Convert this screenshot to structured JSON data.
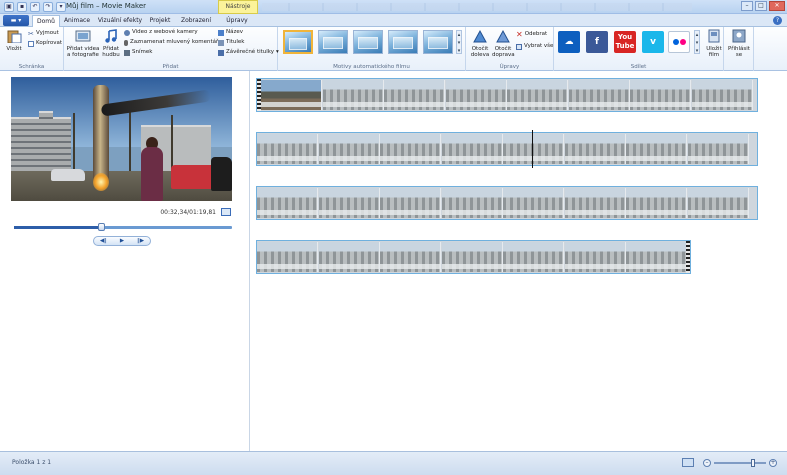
{
  "window": {
    "title": "Můj film – Movie Maker",
    "contextual_tab": "Nástroje videa",
    "minimize": "–",
    "maximize": "□",
    "close": "✕"
  },
  "tabs": [
    {
      "label": "Domů",
      "active": true
    },
    {
      "label": "Animace",
      "active": false
    },
    {
      "label": "Vizuální efekty",
      "active": false
    },
    {
      "label": "Projekt",
      "active": false
    },
    {
      "label": "Zobrazení",
      "active": false
    },
    {
      "label": "Úpravy",
      "active": false
    }
  ],
  "ribbon": {
    "clipboard": {
      "group_label": "Schránka",
      "paste": "Vložit",
      "cut": "Vyjmout",
      "copy": "Kopírovat"
    },
    "add": {
      "group_label": "Přidat",
      "add_video_photos": "Přidat videa a fotografie",
      "add_music": "Přidat hudbu",
      "webcam_video": "Video z webové kamery",
      "record_narration": "Zaznamenat mluvený komentář",
      "snapshot": "Snímek",
      "title": "Název",
      "caption": "Titulek",
      "credits": "Závěrečné titulky"
    },
    "themes": {
      "group_label": "Motivy automatického filmu",
      "count": 5
    },
    "editing": {
      "group_label": "Úpravy",
      "rotate_left": "Otočit doleva",
      "rotate_right": "Otočit doprava",
      "remove": "Odebrat",
      "select_all": "Vybrat vše"
    },
    "share": {
      "group_label": "Sdílet",
      "services": [
        {
          "name": "OneDrive",
          "icon": "cloud-icon",
          "color": "#0d5fbf"
        },
        {
          "name": "Facebook",
          "icon": "facebook-icon",
          "color": "#3b5998"
        },
        {
          "name": "YouTube",
          "icon": "youtube-icon",
          "color": "#d82624"
        },
        {
          "name": "Vimeo",
          "icon": "vimeo-icon",
          "color": "#1ab7ea"
        },
        {
          "name": "Flickr",
          "icon": "flickr-icon",
          "color": "#ffffff"
        }
      ],
      "save_movie": "Uložit film",
      "sign_in": "Přihlásit se"
    }
  },
  "preview": {
    "time": "00:32,34/01:19,81",
    "seek_fraction": 0.4,
    "prev_frame": "◀‖",
    "play": "▶",
    "next_frame": "‖▶"
  },
  "storyboard": {
    "strips": [
      {
        "frames": 8,
        "width_frames": 8.1
      },
      {
        "frames": 8,
        "width_frames": 8.1
      },
      {
        "frames": 8,
        "width_frames": 8.1
      },
      {
        "frames": 7,
        "width_frames": 7.0
      }
    ],
    "playhead_fraction": 0.55
  },
  "status": {
    "text": "Položka 1 z 1",
    "zoom_fraction": 0.75
  },
  "colors": {
    "accent": "#2456a8",
    "strip_border": "#6fb0de",
    "contextual": "#fbf39a"
  }
}
